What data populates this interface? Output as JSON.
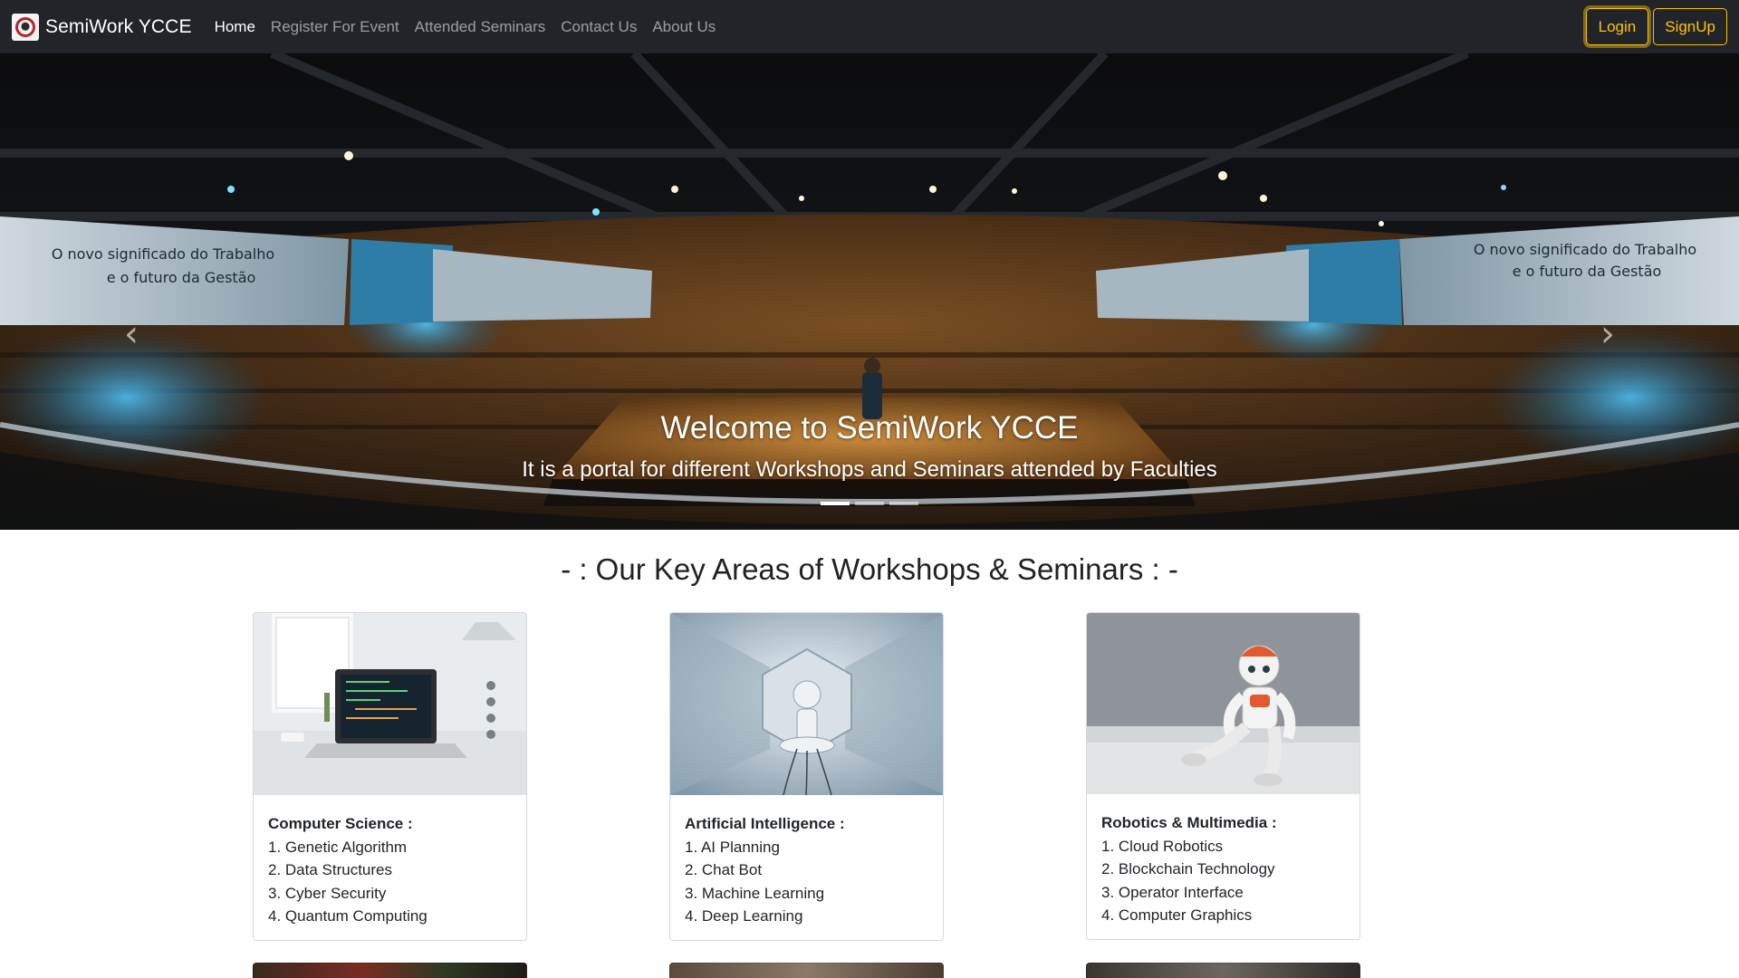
{
  "navbar": {
    "brand": "SemiWork YCCE",
    "links": [
      "Home",
      "Register For Event",
      "Attended Seminars",
      "Contact Us",
      "About Us"
    ],
    "active_link": "Home",
    "login_label": "Login",
    "signup_label": "SignUp"
  },
  "hero": {
    "title": "Welcome to SemiWork YCCE",
    "subtitle": "It is a portal for different Workshops and Seminars attended by Faculties",
    "screen_left_line1": "O novo significado do Trabalho",
    "screen_left_line2": "e o futuro da Gestão",
    "screen_right_line1": "O novo significado do Trabalho",
    "screen_right_line2": "e o futuro da Gestão",
    "slide_count": 3,
    "active_slide": 1
  },
  "section": {
    "title": "- : Our Key Areas of Workshops & Seminars : -"
  },
  "cards": [
    {
      "heading": "Computer Science :",
      "items": [
        "1. Genetic Algorithm",
        "2. Data Structures",
        "3. Cyber Security",
        "4. Quantum Computing"
      ]
    },
    {
      "heading": "Artificial Intelligence :",
      "items": [
        "1. AI Planning",
        "2. Chat Bot",
        "3. Machine Learning",
        "4. Deep Learning"
      ]
    },
    {
      "heading": "Robotics & Multimedia :",
      "items": [
        "1. Cloud Robotics",
        "2. Blockchain Technology",
        "3. Operator Interface",
        "4. Computer Graphics"
      ]
    }
  ],
  "icons": {
    "prev": "chevron-left-icon",
    "next": "chevron-right-icon"
  }
}
